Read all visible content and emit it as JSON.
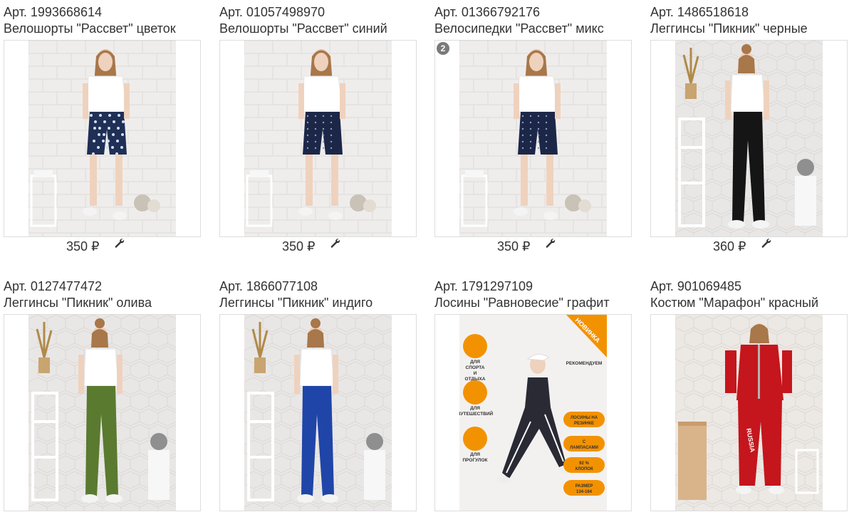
{
  "products": [
    {
      "art": "Арт. 1993668614",
      "name": "Велошорты \"Рассвет\" цветок",
      "price": "350 ₽",
      "badge": "",
      "wall": "#efedec",
      "top": "#ffffff",
      "bottom": "#1f2f55",
      "pattern": "floral"
    },
    {
      "art": "Арт. 01057498970",
      "name": "Велошорты \"Рассвет\" синий",
      "price": "350 ₽",
      "badge": "",
      "wall": "#efedec",
      "top": "#ffffff",
      "bottom": "#1c2748",
      "pattern": "dots"
    },
    {
      "art": "Арт. 01366792176",
      "name": "Велосипедки \"Рассвет\" микс",
      "price": "350 ₽",
      "badge": "2",
      "wall": "#efedec",
      "top": "#ffffff",
      "bottom": "#1c2748",
      "pattern": "dots"
    },
    {
      "art": "Арт. 1486518618",
      "name": "Леггинсы \"Пикник\" черные",
      "price": "360 ₽",
      "badge": "",
      "wall": "#e9e7e6",
      "top": "#ffffff",
      "bottom": "#151515",
      "pattern": "long"
    },
    {
      "art": "Арт. 0127477472",
      "name": "Леггинсы \"Пикник\" олива",
      "price": "",
      "badge": "",
      "wall": "#e9e7e6",
      "top": "#ffffff",
      "bottom": "#5a7a30",
      "pattern": "long"
    },
    {
      "art": "Арт. 1866077108",
      "name": "Леггинсы \"Пикник\" индиго",
      "price": "",
      "badge": "",
      "wall": "#e9e7e6",
      "top": "#ffffff",
      "bottom": "#1f45a8",
      "pattern": "long"
    },
    {
      "art": "Арт. 1791297109",
      "name": "Лосины \"Равновесие\" графит",
      "price": "",
      "badge": "",
      "wall": "#f3f1ef",
      "top": "#2a2a35",
      "bottom": "#2a2a35",
      "pattern": "promo"
    },
    {
      "art": "Арт. 901069485",
      "name": "Костюм \"Марафон\" красный",
      "price": "",
      "badge": "",
      "wall": "#ece8e4",
      "top": "#c4161c",
      "bottom": "#c4161c",
      "pattern": "suit"
    }
  ],
  "promo": {
    "tag": "НОВИНКА",
    "left": [
      "ДЛЯ СПОРТА И ОТДЫХА",
      "ДЛЯ ПУТЕШЕСТВИЙ",
      "ДЛЯ ПРОГУЛОК"
    ],
    "right": [
      "РЕКОМЕНДУЕМ",
      "ЛОСИНЫ НА РЕЗИНКЕ",
      "С ЛАМПАСАМИ",
      "92 % ХЛОПОК",
      "РАЗМЕР 134-164"
    ]
  },
  "suit_print": "RUSSIA",
  "colors": {
    "accent": "#f39200",
    "text": "#333333",
    "border": "#dddddd",
    "badge": "#7a7a7a"
  }
}
